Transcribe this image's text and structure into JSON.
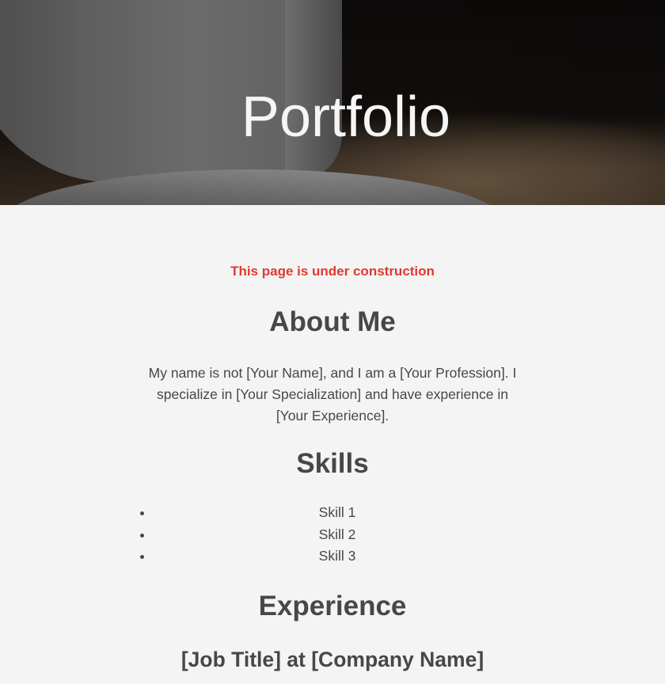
{
  "hero": {
    "title": "Portfolio"
  },
  "notice": "This page is under construction",
  "about": {
    "heading": "About Me",
    "text": "My name is not [Your Name], and I am a [Your Profession]. I specialize in [Your Specialization] and have experience in [Your Experience]."
  },
  "skills": {
    "heading": "Skills",
    "items": [
      "Skill 1",
      "Skill 2",
      "Skill 3"
    ]
  },
  "experience": {
    "heading": "Experience",
    "job_title": "[Job Title] at [Company Name]"
  },
  "colors": {
    "notice": "#e03a2f",
    "text": "#474747",
    "background": "#f4f4f4",
    "hero_title": "#f5f5f5"
  }
}
